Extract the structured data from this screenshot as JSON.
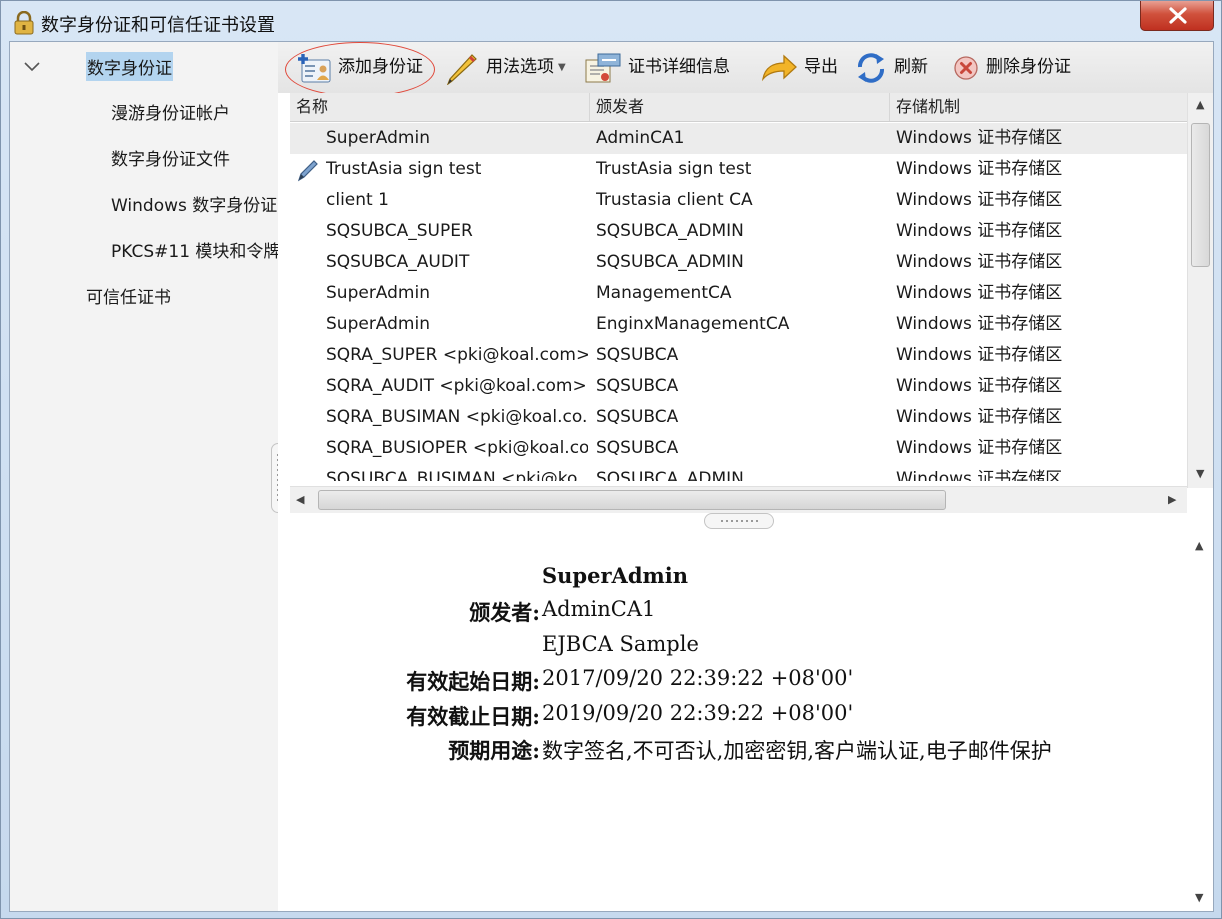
{
  "window": {
    "title": "数字身份证和可信任证书设置",
    "close_label": "✕"
  },
  "sidebar": {
    "items": [
      {
        "label": "数字身份证",
        "selected": true
      },
      {
        "label": "漫游身份证帐户"
      },
      {
        "label": "数字身份证文件"
      },
      {
        "label": "Windows 数字身份证"
      },
      {
        "label": "PKCS#11 模块和令牌"
      },
      {
        "label": "可信任证书"
      }
    ]
  },
  "toolbar": {
    "add_label": "添加身份证",
    "usage_label": "用法选项",
    "details_label": "证书详细信息",
    "export_label": "导出",
    "refresh_label": "刷新",
    "remove_label": "删除身份证"
  },
  "table": {
    "columns": [
      "名称",
      "颁发者",
      "存储机制"
    ],
    "rows": [
      {
        "name": "SuperAdmin",
        "issuer": "AdminCA1",
        "storage": "Windows 证书存储区",
        "selected": true
      },
      {
        "name": "TrustAsia sign test",
        "issuer": "TrustAsia sign test",
        "storage": "Windows 证书存储区",
        "icon": "pen-icon"
      },
      {
        "name": "client 1",
        "issuer": "Trustasia client CA",
        "storage": "Windows 证书存储区"
      },
      {
        "name": "SQSUBCA_SUPER",
        "issuer": "SQSUBCA_ADMIN",
        "storage": "Windows 证书存储区"
      },
      {
        "name": "SQSUBCA_AUDIT",
        "issuer": "SQSUBCA_ADMIN",
        "storage": "Windows 证书存储区"
      },
      {
        "name": "SuperAdmin",
        "issuer": "ManagementCA",
        "storage": "Windows 证书存储区"
      },
      {
        "name": "SuperAdmin",
        "issuer": "EnginxManagementCA",
        "storage": "Windows 证书存储区"
      },
      {
        "name": "SQRA_SUPER <pki@koal.com>",
        "issuer": "SQSUBCA",
        "storage": "Windows 证书存储区"
      },
      {
        "name": "SQRA_AUDIT <pki@koal.com>",
        "issuer": "SQSUBCA",
        "storage": "Windows 证书存储区"
      },
      {
        "name": "SQRA_BUSIMAN <pki@koal.co...",
        "issuer": "SQSUBCA",
        "storage": "Windows 证书存储区"
      },
      {
        "name": "SQRA_BUSIOPER <pki@koal.co...",
        "issuer": "SQSUBCA",
        "storage": "Windows 证书存储区"
      },
      {
        "name": "SQSUBCA_BUSIMAN <pki@ko...",
        "issuer": "SQSUBCA_ADMIN",
        "storage": "Windows 证书存储区"
      }
    ]
  },
  "details": {
    "subject": "SuperAdmin",
    "issuer_label": "颁发者:",
    "issuer_value": "AdminCA1",
    "issuer_value_2": "EJBCA Sample",
    "valid_from_label": "有效起始日期:",
    "valid_from_value": "2017/09/20 22:39:22 +08'00'",
    "valid_to_label": "有效截止日期:",
    "valid_to_value": "2019/09/20 22:39:22 +08'00'",
    "usage_label": "预期用途:",
    "usage_value": "数字签名,不可否认,加密密钥,客户端认证,电子邮件保护"
  },
  "colors": {
    "accent_selection": "#b3d4ef",
    "highlight_circle": "#e04a3c",
    "close_button": "#c8402c"
  }
}
